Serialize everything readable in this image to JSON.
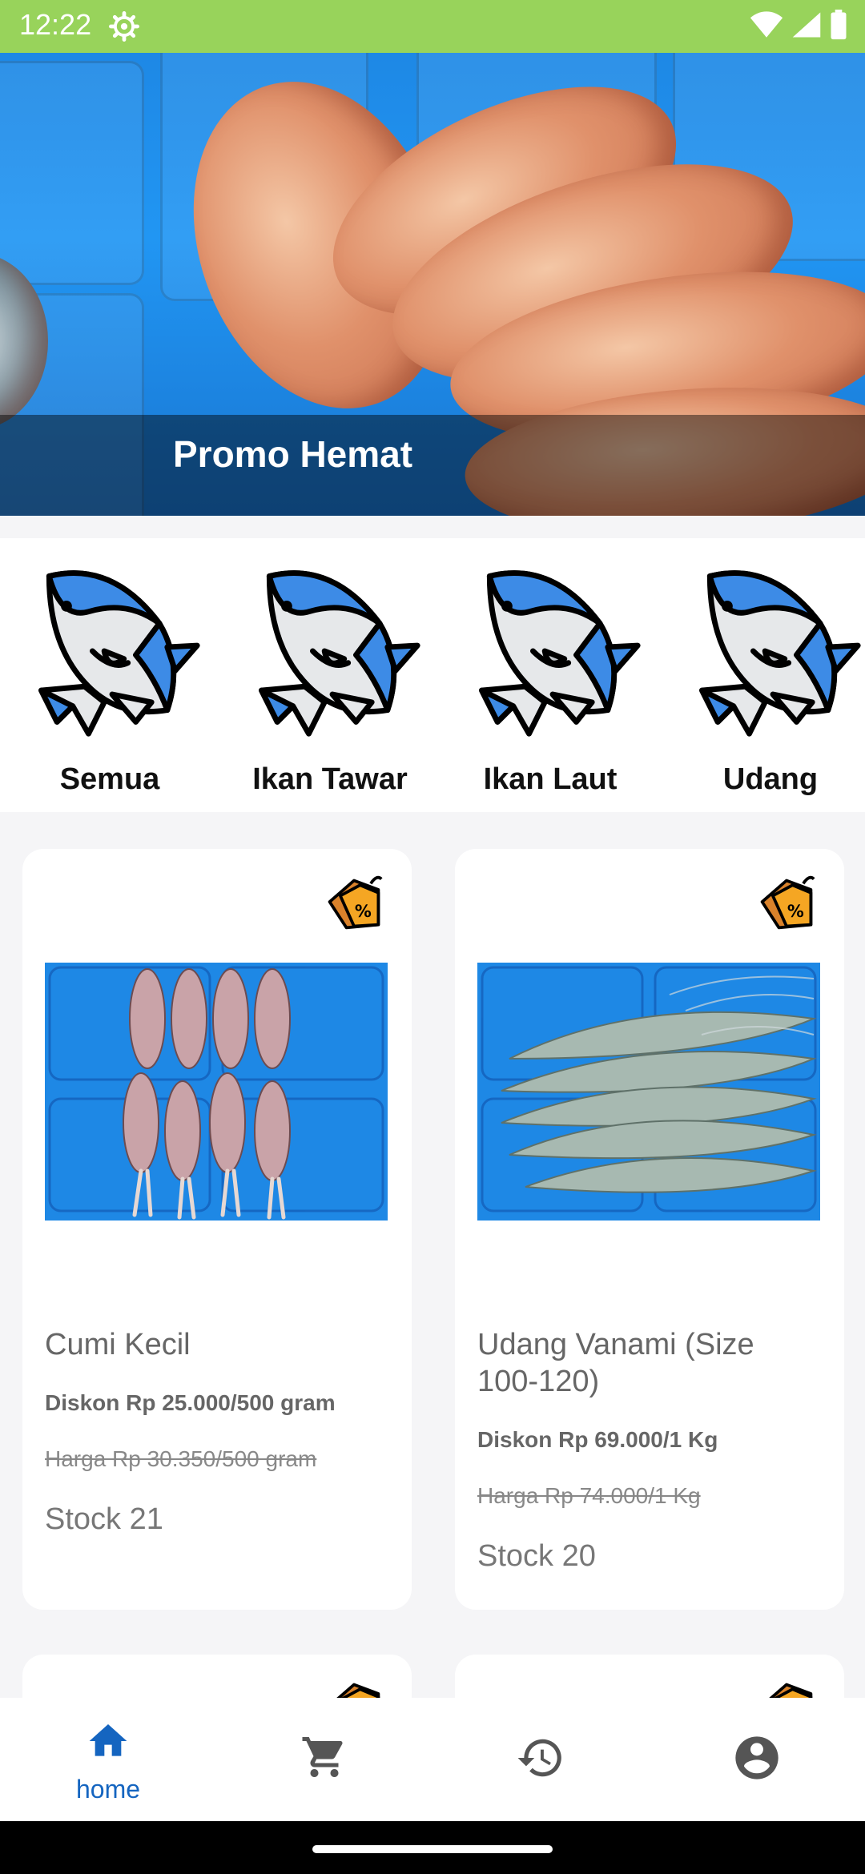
{
  "status_bar": {
    "time": "12:22"
  },
  "banner": {
    "title": "Promo Hemat",
    "dot_count": 4,
    "active_dot": 2
  },
  "categories": [
    {
      "label": "Semua"
    },
    {
      "label": "Ikan Tawar"
    },
    {
      "label": "Ikan Laut"
    },
    {
      "label": "Udang"
    }
  ],
  "products": [
    {
      "name": "Cumi Kecil",
      "discount": "Diskon Rp 25.000/500 gram",
      "price": "Harga Rp 30.350/500 gram",
      "stock": "Stock 21"
    },
    {
      "name": "Udang Vanami (Size 100-120)",
      "discount": "Diskon Rp 69.000/1 Kg",
      "price": "Harga Rp 74.000/1 Kg",
      "stock": "Stock 20"
    }
  ],
  "bottom_nav": {
    "items": [
      {
        "icon": "home-icon",
        "label": "home",
        "active": true
      },
      {
        "icon": "cart-icon",
        "label": ""
      },
      {
        "icon": "history-icon",
        "label": ""
      },
      {
        "icon": "account-icon",
        "label": ""
      }
    ]
  },
  "colors": {
    "status_bar": "#98d35b",
    "accent": "#1565c0",
    "category_fish": "#3d8be6"
  }
}
